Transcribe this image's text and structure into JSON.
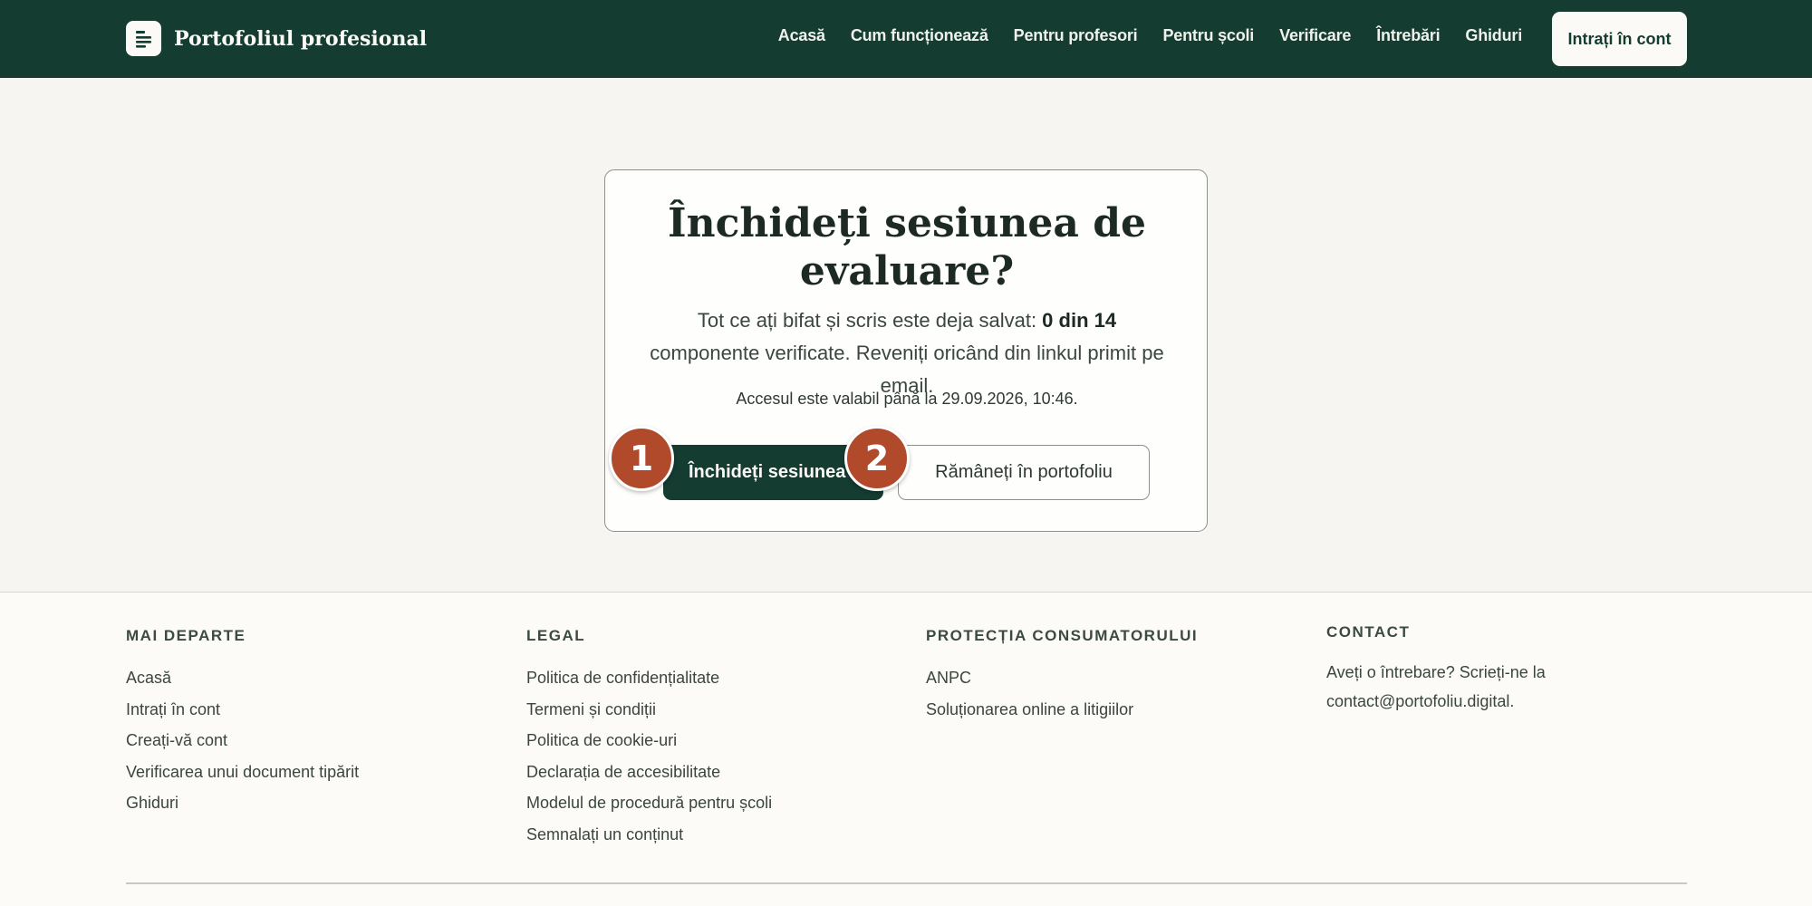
{
  "header": {
    "brand": "Portofoliul profesional",
    "nav": [
      "Acasă",
      "Cum funcționează",
      "Pentru profesori",
      "Pentru școli",
      "Verificare",
      "Întrebări",
      "Ghiduri"
    ],
    "login": "Intrați în cont"
  },
  "dialog": {
    "title": "Închideți sesiunea de evaluare?",
    "desc_pre": "Tot ce ați bifat și scris este deja salvat: ",
    "desc_bold": "0 din 14",
    "desc_post": " componente verificate. Reveniți oricând din linkul primit pe email.",
    "note": "Accesul este valabil până la 29.09.2026, 10:46.",
    "close_label": "Închideți sesiunea",
    "stay_label": "Rămâneți în portofoliu",
    "badge_1": "1",
    "badge_2": "2"
  },
  "footer": {
    "col1": {
      "title": "MAI DEPARTE",
      "links": [
        "Acasă",
        "Intrați în cont",
        "Creați-vă cont",
        "Verificarea unui document tipărit",
        "Ghiduri"
      ]
    },
    "col2": {
      "title": "LEGAL",
      "links": [
        "Politica de confidențialitate",
        "Termeni și condiții",
        "Politica de cookie-uri",
        "Declarația de accesibilitate",
        "Modelul de procedură pentru școli",
        "Semnalați un conținut"
      ]
    },
    "col3": {
      "title": "PROTECȚIA CONSUMATORULUI",
      "links": [
        "ANPC",
        "Soluționarea online a litigiilor"
      ]
    },
    "col4": {
      "title": "CONTACT",
      "text": "Aveți o întrebare? Scrieți-ne la contact@portofoliu.digital."
    }
  },
  "colors": {
    "brand_green": "#153c31",
    "badge": "#b04a2b",
    "page_bg": "#f6f5f1"
  }
}
